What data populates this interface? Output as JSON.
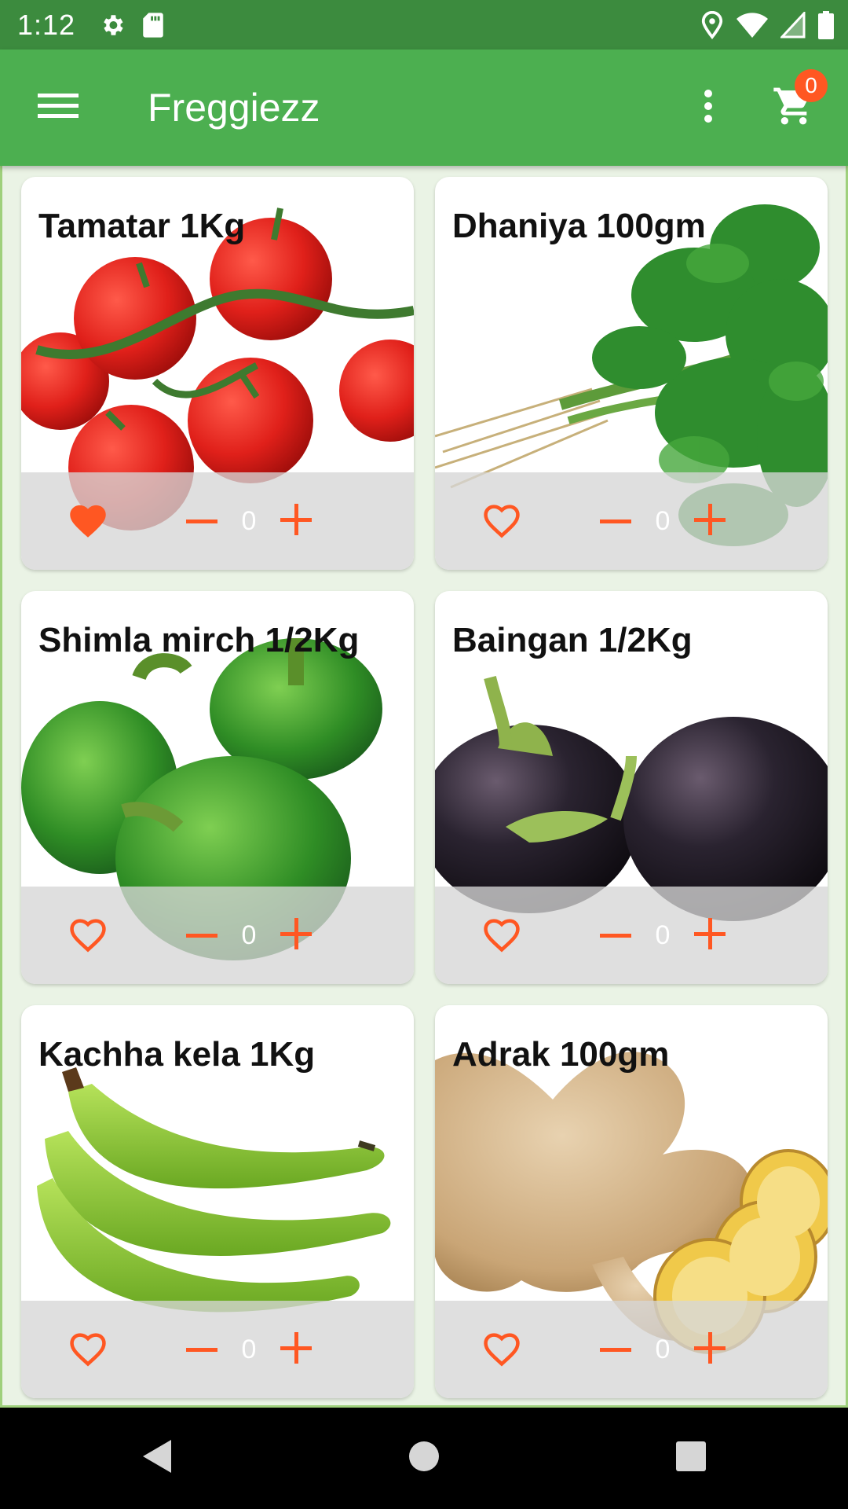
{
  "status_bar": {
    "time": "1:12",
    "icons": [
      "gear-icon",
      "sd-card-icon",
      "location-icon",
      "wifi-icon",
      "signal-icon",
      "battery-icon"
    ]
  },
  "app_bar": {
    "title": "Freggiezz",
    "cart_count": "0",
    "icons": [
      "menu-icon",
      "more-vert-icon",
      "cart-icon"
    ]
  },
  "colors": {
    "primary": "#4caf50",
    "primary_dark": "#3c8b3e",
    "accent": "#ff5722"
  },
  "products": [
    {
      "name": "Tamatar 1Kg",
      "quantity": "0",
      "favorite": true,
      "image": "tomatoes"
    },
    {
      "name": "Dhaniya 100gm",
      "quantity": "0",
      "favorite": false,
      "image": "coriander"
    },
    {
      "name": "Shimla mirch 1/2Kg",
      "quantity": "0",
      "favorite": false,
      "image": "green-capsicum"
    },
    {
      "name": "Baingan 1/2Kg",
      "quantity": "0",
      "favorite": false,
      "image": "eggplants"
    },
    {
      "name": "Kachha kela 1Kg",
      "quantity": "0",
      "favorite": false,
      "image": "raw-bananas"
    },
    {
      "name": "Adrak 100gm",
      "quantity": "0",
      "favorite": false,
      "image": "ginger"
    }
  ],
  "nav_bar": {
    "icons": [
      "back-icon",
      "home-icon",
      "recents-icon"
    ]
  }
}
